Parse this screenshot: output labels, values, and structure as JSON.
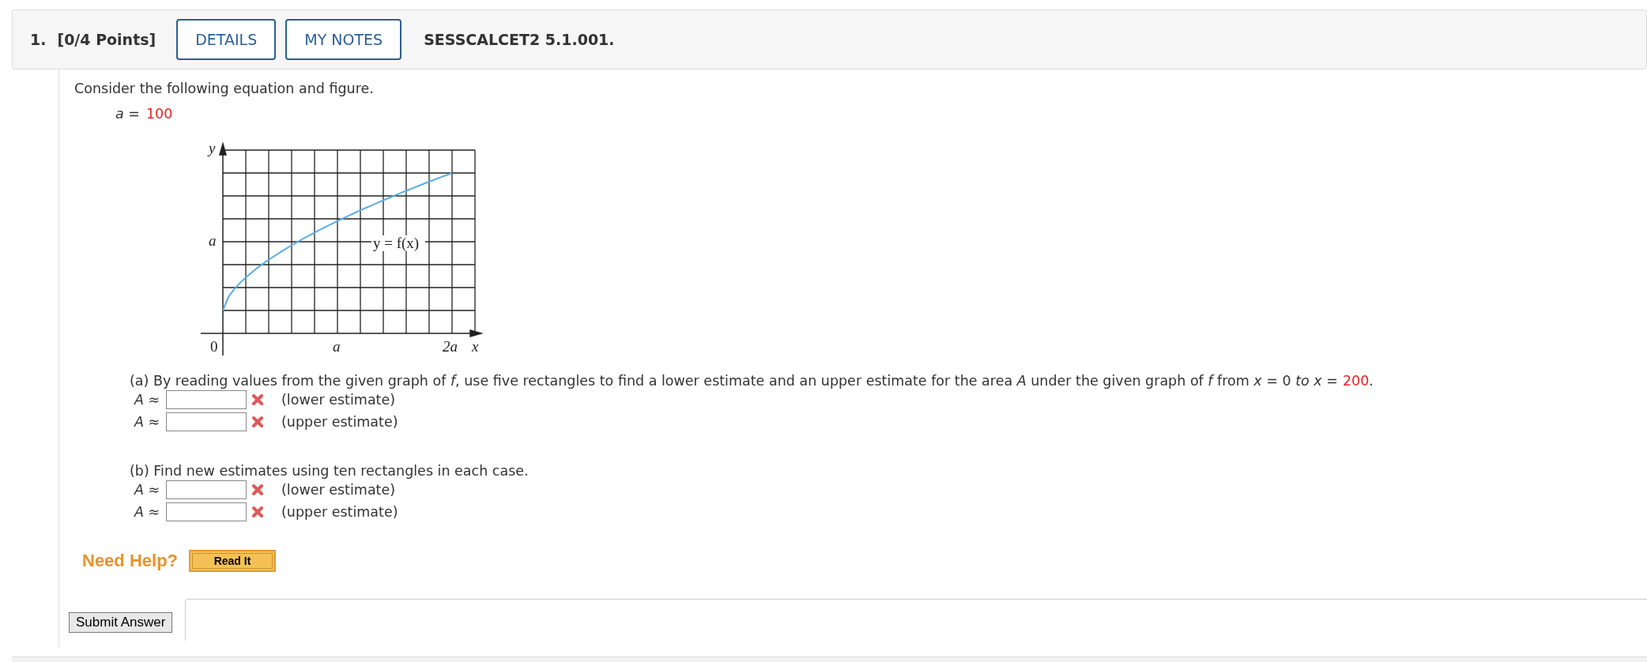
{
  "header": {
    "number": "1.",
    "points": "[0/4 Points]",
    "buttons": [
      "DETAILS",
      "MY NOTES"
    ],
    "code": "SESSCALCET2 5.1.001."
  },
  "intro": "Consider the following equation and figure.",
  "equation": {
    "lhs": "*a* =",
    "value": "100"
  },
  "figure": {
    "y_axis": "y",
    "y_tick": "a",
    "origin": "0",
    "x_ticks": [
      "a",
      "2a"
    ],
    "x_axis": "x",
    "curve_label": "y = f(x)"
  },
  "parts": [
    {
      "prompt": "(a) By reading values from the given graph of *f*, use five rectangles to find a lower estimate and an upper estimate for the area *A* under the given graph of *f* from  *x* = 0 *to x* =",
      "value": "200",
      "end": ".",
      "answers": [
        {
          "label": "*A* ≈",
          "correct": false,
          "note": "(lower estimate)"
        },
        {
          "label": "*A* ≈",
          "correct": false,
          "note": "(upper estimate)"
        }
      ]
    },
    {
      "prompt": "(b) Find new estimates using ten rectangles in each case.",
      "answers": [
        {
          "label": "*A* ≈",
          "correct": false,
          "note": "(lower estimate)"
        },
        {
          "label": "*A* ≈",
          "correct": false,
          "note": "(upper estimate)"
        }
      ]
    }
  ],
  "help": {
    "label": "Need Help?",
    "button": "Read It"
  },
  "submit": "Submit Answer"
}
